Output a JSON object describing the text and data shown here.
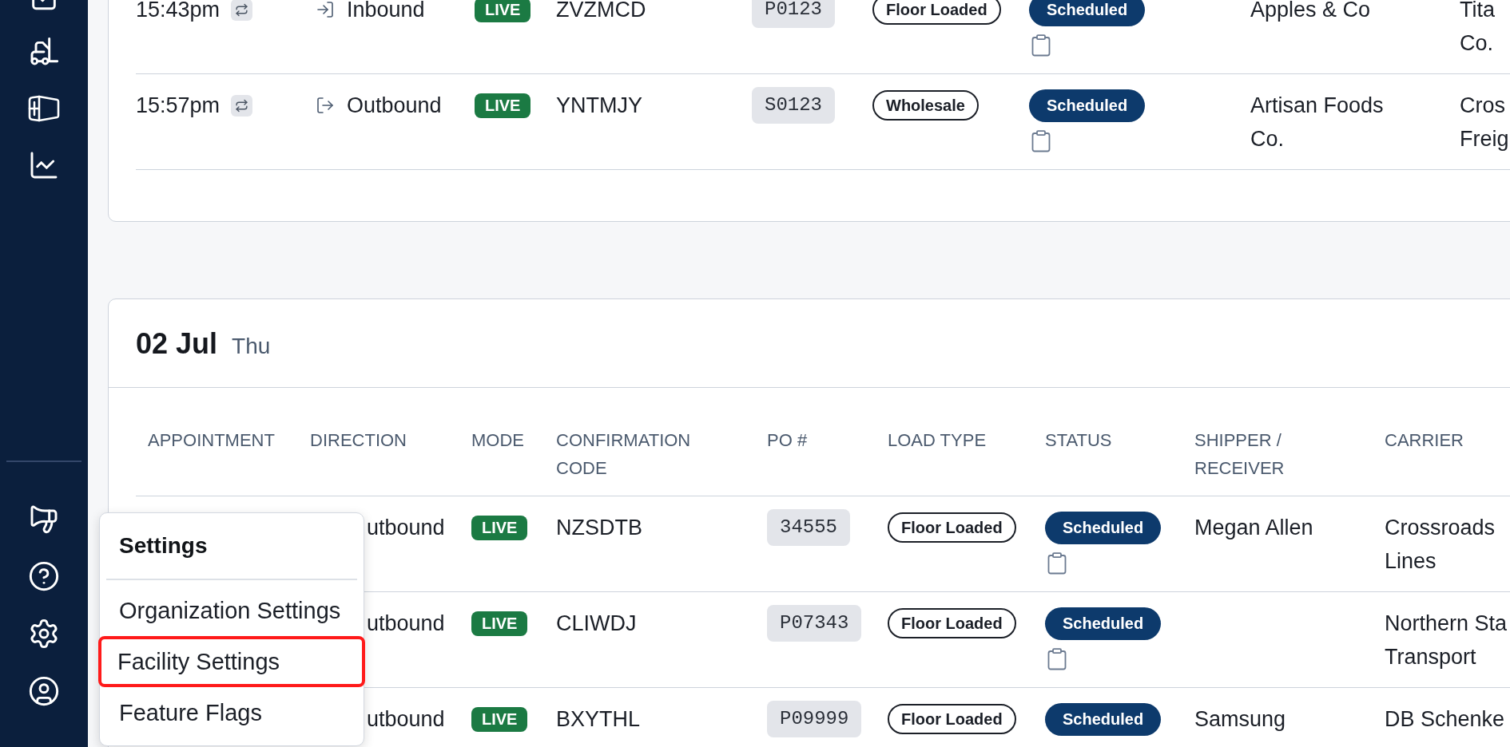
{
  "days": [
    {
      "rows": [
        {
          "kind": "inbound",
          "appointment": "15:43pm",
          "recurring": true,
          "direction": "Inbound",
          "mode": "LIVE",
          "confirmation_code": "ZVZMCD",
          "po_number": "P0123",
          "load_type": "Floor Loaded",
          "status": "Scheduled",
          "notes": true,
          "shipper_receiver": "Apples & Co",
          "carrier": "Tita Co."
        },
        {
          "kind": "outbound",
          "appointment": "15:57pm",
          "recurring": true,
          "direction": "Outbound",
          "mode": "LIVE",
          "confirmation_code": "YNTMJY",
          "po_number": "S0123",
          "load_type": "Wholesale",
          "status": "Scheduled",
          "notes": true,
          "shipper_receiver": "Artisan Foods Co.",
          "carrier": "Cros Freig"
        }
      ]
    },
    {
      "date": "02 Jul",
      "weekday": "Thu",
      "columns": [
        "APPOINTMENT",
        "DIRECTION",
        "MODE",
        "CONFIRMATION CODE",
        "PO #",
        "LOAD TYPE",
        "STATUS",
        "SHIPPER / RECEIVER",
        "CARRIER"
      ],
      "rows": [
        {
          "direction": "utbound",
          "mode": "LIVE",
          "confirmation_code": "NZSDTB",
          "po_number": "34555",
          "load_type": "Floor Loaded",
          "status": "Scheduled",
          "notes": true,
          "shipper_receiver": "Megan Allen",
          "carrier": "Crossroads Lines"
        },
        {
          "direction": "utbound",
          "mode": "LIVE",
          "confirmation_code": "CLIWDJ",
          "po_number": "P07343",
          "load_type": "Floor Loaded",
          "status": "Scheduled",
          "notes": true,
          "carrier": "Northern Sta Transport"
        },
        {
          "direction": "utbound",
          "mode": "LIVE",
          "confirmation_code": "BXYTHL",
          "po_number": "P09999",
          "load_type": "Floor Loaded",
          "status": "Scheduled",
          "shipper_receiver": "Samsung",
          "carrier": "DB Schenke"
        }
      ]
    }
  ],
  "settings_menu": {
    "title": "Settings",
    "items": [
      {
        "label": "Organization Settings",
        "highlighted": false
      },
      {
        "label": "Facility Settings",
        "highlighted": true
      },
      {
        "label": "Feature Flags",
        "highlighted": false
      }
    ]
  }
}
